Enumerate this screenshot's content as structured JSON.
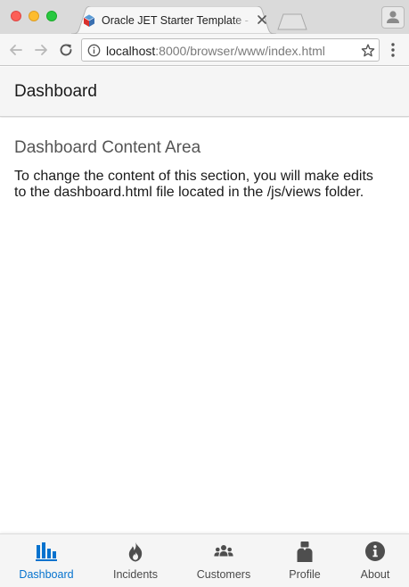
{
  "browser": {
    "tab": {
      "title": "Oracle JET Starter Template - ",
      "favicon": "oracle-jet-logo-icon"
    },
    "address": {
      "host": "localhost",
      "rest": ":8000/browser/www/index.html"
    },
    "icons": [
      "back-arrow-icon",
      "forward-arrow-icon",
      "reload-icon",
      "info-icon",
      "star-icon",
      "kebab-menu-icon",
      "profile-icon",
      "close-icon"
    ]
  },
  "header": {
    "title": "Dashboard"
  },
  "content": {
    "heading": "Dashboard Content Area",
    "body": "To change the content of this section, you will make edits to the dashboard.html file located in the /js/views folder."
  },
  "bottom_nav": {
    "active": "Dashboard",
    "active_color": "#0572ce",
    "items": [
      {
        "label": "Dashboard",
        "icon": "bar-chart-icon"
      },
      {
        "label": "Incidents",
        "icon": "fire-icon"
      },
      {
        "label": "Customers",
        "icon": "people-icon"
      },
      {
        "label": "Profile",
        "icon": "person-badge-icon"
      },
      {
        "label": "About",
        "icon": "info-circle-icon"
      }
    ]
  }
}
